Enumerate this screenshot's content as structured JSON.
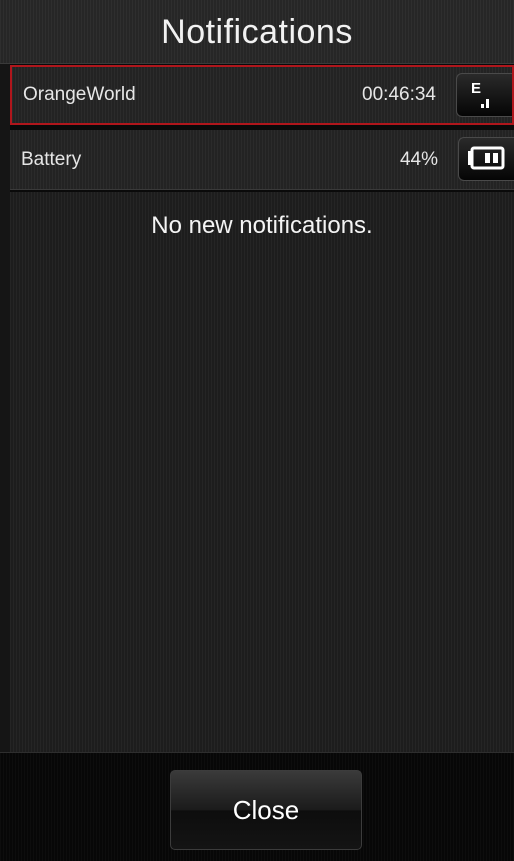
{
  "header": {
    "title": "Notifications"
  },
  "items": [
    {
      "label": "OrangeWorld",
      "value": "00:46:34",
      "icon": "edge-signal-icon"
    },
    {
      "label": "Battery",
      "value": "44%",
      "icon": "battery-icon"
    }
  ],
  "main": {
    "empty_message": "No new notifications."
  },
  "footer": {
    "close_label": "Close"
  },
  "colors": {
    "selection_border": "#b0161c",
    "background": "#1d1d1d"
  }
}
